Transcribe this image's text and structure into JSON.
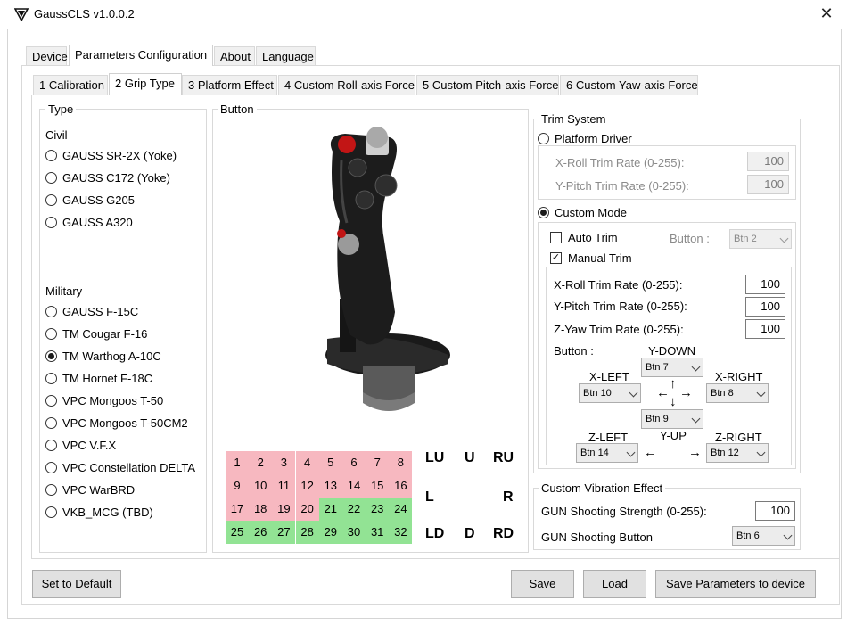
{
  "window": {
    "title": "GaussCLS v1.0.0.2",
    "close_glyph": "✕"
  },
  "main_tabs": [
    {
      "label": "Device"
    },
    {
      "label": "Parameters Configuration"
    },
    {
      "label": "About"
    },
    {
      "label": "Language"
    }
  ],
  "sub_tabs": [
    {
      "label": "1 Calibration"
    },
    {
      "label": "2 Grip Type"
    },
    {
      "label": "3 Platform Effect"
    },
    {
      "label": "4 Custom Roll-axis Force"
    },
    {
      "label": "5 Custom Pitch-axis Force"
    },
    {
      "label": "6 Custom Yaw-axis Force"
    }
  ],
  "type_group": {
    "title": "Type",
    "civil_label": "Civil",
    "civil": [
      "GAUSS SR-2X (Yoke)",
      "GAUSS C172 (Yoke)",
      "GAUSS G205",
      "GAUSS A320"
    ],
    "military_label": "Military",
    "military": [
      "GAUSS F-15C",
      "TM Cougar F-16",
      "TM Warthog A-10C",
      "TM Hornet F-18C",
      "VPC Mongoos T-50",
      "VPC Mongoos T-50CM2",
      "VPC V.F.X",
      "VPC Constellation DELTA",
      "VPC WarBRD",
      "VKB_MCG (TBD)"
    ],
    "selected": "TM Warthog A-10C"
  },
  "button_group": {
    "title": "Button",
    "grid": [
      {
        "n": "1",
        "color": "pink"
      },
      {
        "n": "2",
        "color": "pink"
      },
      {
        "n": "3",
        "color": "pink"
      },
      {
        "n": "4",
        "color": "pink"
      },
      {
        "n": "5",
        "color": "pink"
      },
      {
        "n": "6",
        "color": "pink"
      },
      {
        "n": "7",
        "color": "pink"
      },
      {
        "n": "8",
        "color": "pink"
      },
      {
        "n": "9",
        "color": "pink"
      },
      {
        "n": "10",
        "color": "pink"
      },
      {
        "n": "11",
        "color": "pink"
      },
      {
        "n": "12",
        "color": "pink"
      },
      {
        "n": "13",
        "color": "pink"
      },
      {
        "n": "14",
        "color": "pink"
      },
      {
        "n": "15",
        "color": "pink"
      },
      {
        "n": "16",
        "color": "pink"
      },
      {
        "n": "17",
        "color": "pink"
      },
      {
        "n": "18",
        "color": "pink"
      },
      {
        "n": "19",
        "color": "pink"
      },
      {
        "n": "20",
        "color": "pink"
      },
      {
        "n": "21",
        "color": "green"
      },
      {
        "n": "22",
        "color": "green"
      },
      {
        "n": "23",
        "color": "green"
      },
      {
        "n": "24",
        "color": "green"
      },
      {
        "n": "25",
        "color": "green"
      },
      {
        "n": "26",
        "color": "green"
      },
      {
        "n": "27",
        "color": "green"
      },
      {
        "n": "28",
        "color": "green"
      },
      {
        "n": "29",
        "color": "green"
      },
      {
        "n": "30",
        "color": "green"
      },
      {
        "n": "31",
        "color": "green"
      },
      {
        "n": "32",
        "color": "green"
      }
    ],
    "directions": {
      "lu": "LU",
      "u": "U",
      "ru": "RU",
      "l": "L",
      "r": "R",
      "ld": "LD",
      "d": "D",
      "rd": "RD"
    }
  },
  "trim": {
    "title": "Trim System",
    "platform_driver": {
      "label": "Platform Driver",
      "x_roll_label": "X-Roll Trim Rate (0-255):",
      "x_roll_value": "100",
      "y_pitch_label": "Y-Pitch Trim Rate (0-255):",
      "y_pitch_value": "100"
    },
    "custom_mode": {
      "label": "Custom Mode",
      "auto_trim_label": "Auto Trim",
      "button_label": "Button :",
      "auto_button": "Btn 2",
      "manual_trim_label": "Manual Trim",
      "x_roll_label": "X-Roll Trim Rate (0-255):",
      "x_roll_value": "100",
      "y_pitch_label": "Y-Pitch Trim Rate (0-255):",
      "y_pitch_value": "100",
      "z_yaw_label": "Z-Yaw Trim Rate (0-255):",
      "z_yaw_value": "100",
      "buttons_label": "Button :",
      "y_down_label": "Y-DOWN",
      "y_down": "Btn 7",
      "x_left_label": "X-LEFT",
      "x_left": "Btn 10",
      "x_right_label": "X-RIGHT",
      "x_right": "Btn 8",
      "y_up_label": "Y-UP",
      "y_up": "Btn 9",
      "z_left_label": "Z-LEFT",
      "z_left": "Btn 14",
      "z_right_label": "Z-RIGHT",
      "z_right": "Btn 12",
      "arrow_left": "←",
      "arrow_right": "→",
      "arrow_up": "↑",
      "arrow_down": "↓"
    },
    "selected_mode": "Custom Mode",
    "auto_trim_checked": false,
    "manual_trim_checked": true
  },
  "vibration": {
    "title": "Custom Vibration Effect",
    "strength_label": "GUN Shooting Strength (0-255):",
    "strength_value": "100",
    "button_label": "GUN Shooting Button",
    "button_value": "Btn 6"
  },
  "footer": {
    "set_default": "Set to Default",
    "save": "Save",
    "load": "Load",
    "save_device": "Save Parameters to device"
  }
}
